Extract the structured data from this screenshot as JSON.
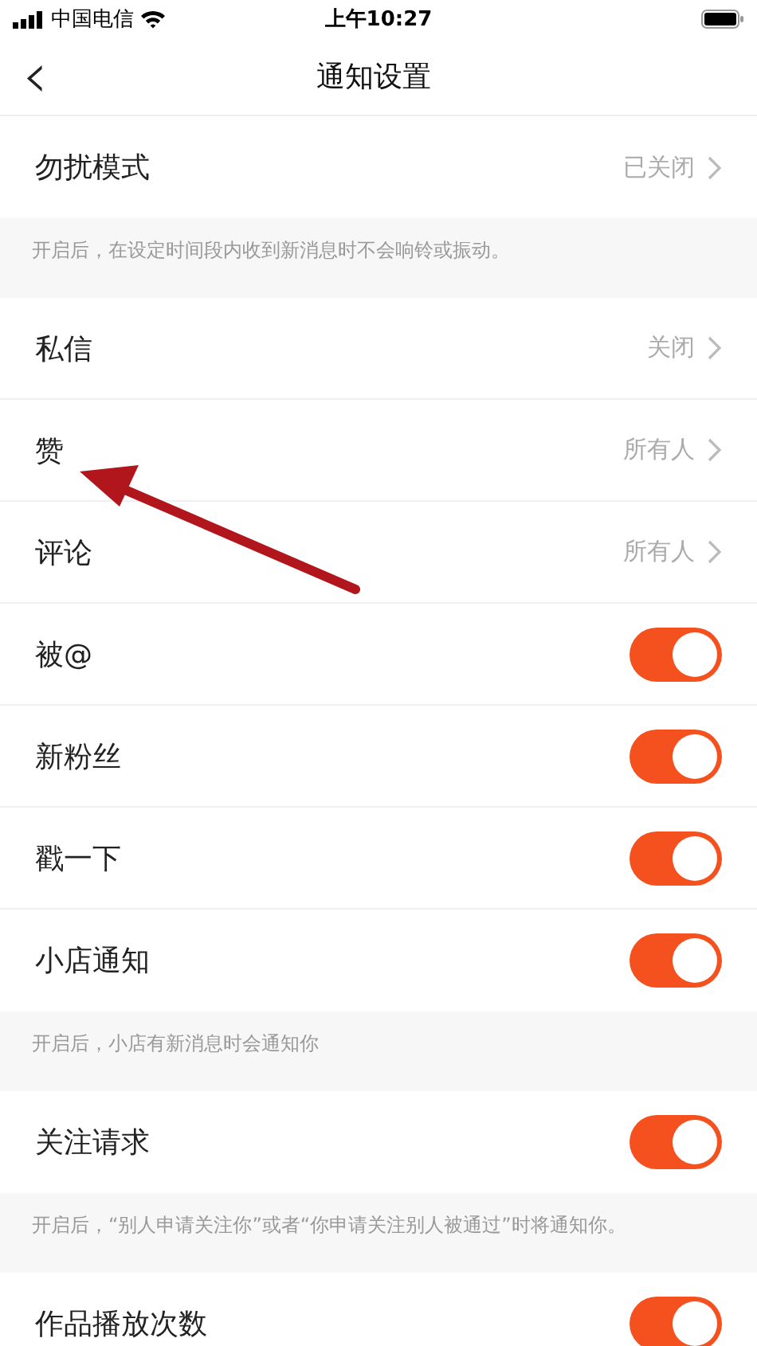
{
  "status_bar": {
    "carrier": "中国电信",
    "time": "上午10:27"
  },
  "nav": {
    "back": "‹",
    "title": "通知设置"
  },
  "sections": [
    {
      "rows": [
        {
          "kind": "link",
          "label": "勿扰模式",
          "value": "已关闭"
        }
      ],
      "hint": "开启后，在设定时间段内收到新消息时不会响铃或振动。"
    },
    {
      "rows": [
        {
          "kind": "link",
          "label": "私信",
          "value": "关闭"
        },
        {
          "kind": "link",
          "label": "赞",
          "value": "所有人"
        },
        {
          "kind": "link",
          "label": "评论",
          "value": "所有人"
        },
        {
          "kind": "switch",
          "label": "被@",
          "on": true
        },
        {
          "kind": "switch",
          "label": "新粉丝",
          "on": true
        },
        {
          "kind": "switch",
          "label": "戳一下",
          "on": true
        },
        {
          "kind": "switch",
          "label": "小店通知",
          "on": true
        }
      ],
      "hint": "开启后，小店有新消息时会通知你"
    },
    {
      "rows": [
        {
          "kind": "switch",
          "label": "关注请求",
          "on": true
        }
      ],
      "hint": "开启后，“别人申请关注你”或者“你申请关注别人被通过”时将通知你。"
    },
    {
      "rows": [
        {
          "kind": "switch",
          "label": "作品播放次数",
          "on": true
        }
      ]
    }
  ]
}
